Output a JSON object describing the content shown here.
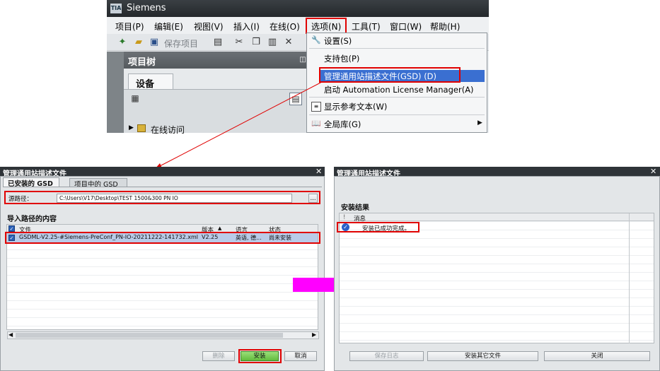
{
  "tia": {
    "logo_text": "TIA",
    "app_title": "Siemens",
    "menu": [
      "项目(P)",
      "编辑(E)",
      "视图(V)",
      "插入(I)",
      "在线(O)",
      "选项(N)",
      "工具(T)",
      "窗口(W)",
      "帮助(H)"
    ],
    "save_project": "保存项目",
    "project_tree_title": "项目树",
    "devices_tab": "设备",
    "online_access": "在线访问"
  },
  "options_menu": {
    "settings": "设置(S)",
    "support_packages": "支持包(P)",
    "manage_gsd": "管理通用站描述文件(GSD) (D)",
    "license_manager": "启动 Automation License Manager(A)",
    "show_reference_text": "显示参考文本(W)",
    "global_libraries": "全局库(G)"
  },
  "dialog_left": {
    "title": "管理通用站描述文件",
    "tabs": [
      "已安装的 GSD",
      "项目中的 GSD"
    ],
    "source_path_label": "源路径：",
    "source_path_value": "C:\\Users\\V17\\Desktop\\TEST 1500&300 PN IO",
    "browse_label": "...",
    "import_section": "导入路径的内容",
    "columns": [
      "文件",
      "版本",
      "语言",
      "状态"
    ],
    "rows": [
      {
        "file": "GSDML-V2.25-#Siemens-PreConf_PN-IO-20211222-141732.xml",
        "version": "V2.25",
        "language": "英语, 德...",
        "status": "尚未安装"
      }
    ],
    "buttons": {
      "delete": "删除",
      "install": "安装",
      "cancel": "取消"
    }
  },
  "dialog_right": {
    "title": "管理通用站描述文件",
    "section": "安装结果",
    "columns": [
      "!",
      "消息"
    ],
    "rows": [
      {
        "message": "安装已成功完成。"
      }
    ],
    "buttons": {
      "save_log": "保存日志",
      "install_other": "安装其它文件",
      "close": "关闭"
    }
  },
  "colors": {
    "highlight_red": "#e00000",
    "arrow_magenta": "#ff00ff",
    "selection_blue": "#3a6fd1",
    "install_green": "#7fcf5a"
  }
}
